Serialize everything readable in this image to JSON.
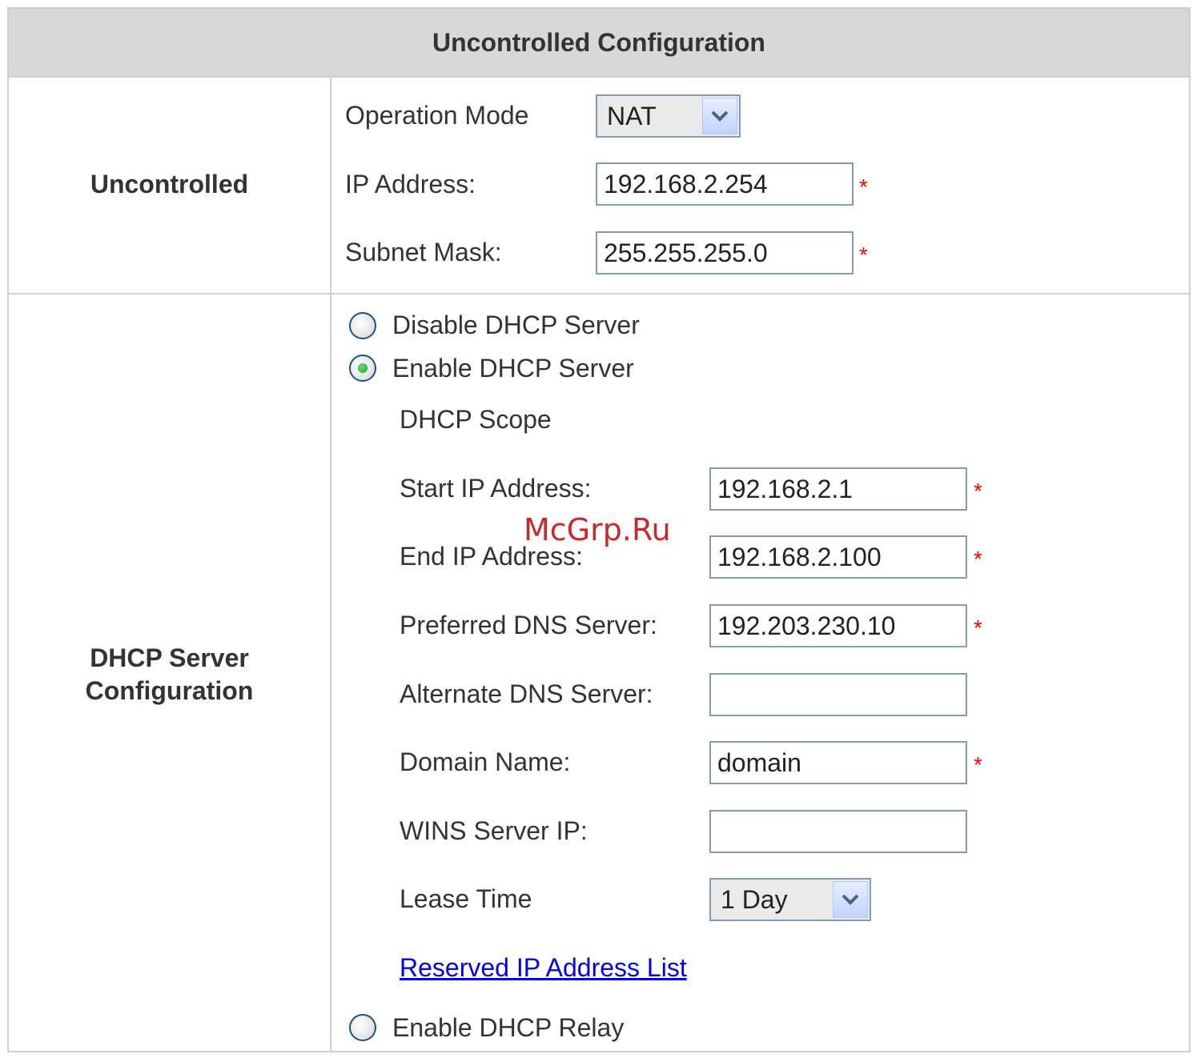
{
  "header": {
    "title": "Uncontrolled Configuration"
  },
  "uncontrolled": {
    "section_label": "Uncontrolled",
    "operation_mode_label": "Operation Mode",
    "operation_mode_value": "NAT",
    "ip_address_label": "IP Address:",
    "ip_address_value": "192.168.2.254",
    "subnet_mask_label": "Subnet Mask:",
    "subnet_mask_value": "255.255.255.0",
    "required_mark": "*"
  },
  "dhcp": {
    "section_label_line1": "DHCP Server",
    "section_label_line2": "Configuration",
    "disable_label": "Disable DHCP Server",
    "enable_label": "Enable DHCP Server",
    "relay_label": "Enable DHCP Relay",
    "selected_option": "Enable DHCP Server",
    "scope_label": "DHCP Scope",
    "start_ip_label": "Start IP Address:",
    "start_ip_value": "192.168.2.1",
    "end_ip_label": "End IP Address:",
    "end_ip_value": "192.168.2.100",
    "preferred_dns_label": "Preferred DNS Server:",
    "preferred_dns_value": "192.203.230.10",
    "alternate_dns_label": "Alternate DNS Server:",
    "alternate_dns_value": "",
    "domain_name_label": "Domain Name:",
    "domain_name_value": "domain",
    "wins_label": "WINS Server IP:",
    "wins_value": "",
    "lease_time_label": "Lease Time",
    "lease_time_value": "1 Day",
    "reserved_link": "Reserved IP Address List",
    "required_mark": "*"
  },
  "watermark": "McGrp.Ru",
  "colors": {
    "header_bg": "#d8d8d8",
    "border": "#d0d0d0",
    "input_border": "#7f9db9",
    "required": "#ff0000",
    "link": "#0000ee"
  },
  "icons": {
    "select_arrow": "chevron-down-icon",
    "radio": "radio-icon"
  }
}
